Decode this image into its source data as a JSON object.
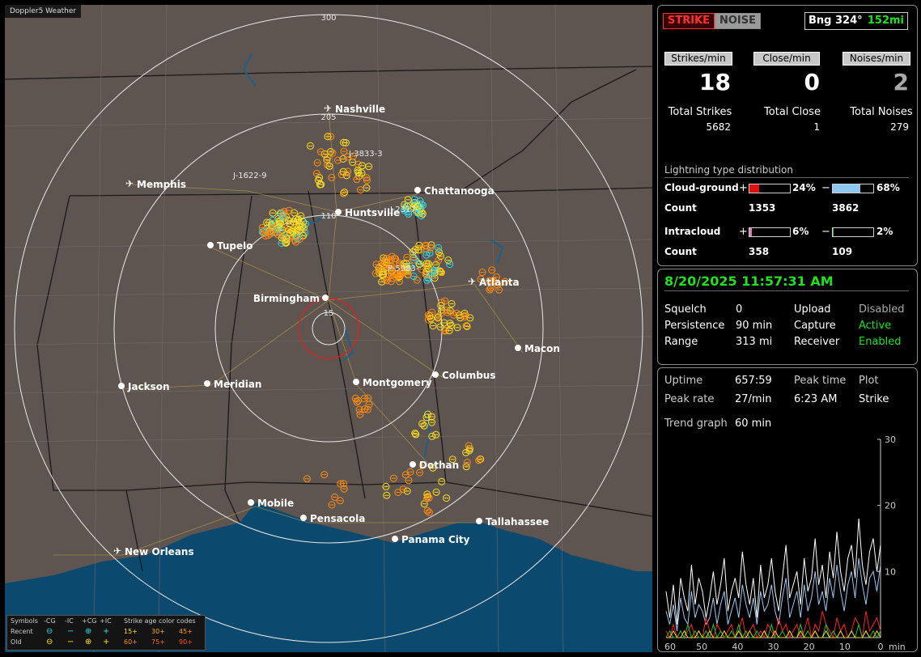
{
  "app": {
    "brand": "Doppler5 Weather"
  },
  "map": {
    "range_labels": [
      "300",
      "205",
      "110",
      "15"
    ],
    "cities": [
      {
        "name": "Nashville",
        "airport": true
      },
      {
        "name": "Memphis",
        "airport": true
      },
      {
        "name": "Chattanooga",
        "airport": false
      },
      {
        "name": "Huntsville",
        "airport": false
      },
      {
        "name": "Tupelo",
        "airport": false
      },
      {
        "name": "Birmingham",
        "airport": false
      },
      {
        "name": "Atlanta",
        "airport": true
      },
      {
        "name": "Macon",
        "airport": false
      },
      {
        "name": "Jackson",
        "airport": false
      },
      {
        "name": "Meridian",
        "airport": false
      },
      {
        "name": "Montgomery",
        "airport": false
      },
      {
        "name": "Columbus",
        "airport": false
      },
      {
        "name": "Dothan",
        "airport": false
      },
      {
        "name": "Mobile",
        "airport": false
      },
      {
        "name": "Pensacola",
        "airport": false
      },
      {
        "name": "Tallahassee",
        "airport": false
      },
      {
        "name": "Panama City",
        "airport": false
      },
      {
        "name": "New Orleans",
        "airport": true
      }
    ],
    "cell_tags": [
      "J-1622-9",
      "J-3833-3",
      "J-2317-",
      "P-5983-"
    ],
    "legend": {
      "symbols_label": "Symbols",
      "cols": [
        "-CG",
        "-IC",
        "+CG",
        "+IC"
      ],
      "age_title": "Strike age color codes",
      "recent_label": "Recent",
      "old_label": "Old",
      "recent_symbols": [
        "⊖",
        "−",
        "⊕",
        "+"
      ],
      "old_symbols": [
        "⊖",
        "−",
        "⊕",
        "+"
      ],
      "recent_ages": [
        "15+",
        "30+",
        "45+"
      ],
      "old_ages": [
        "60+",
        "75+",
        "90+"
      ]
    }
  },
  "top": {
    "strike_button": "STRIKE",
    "noise_button": "NOISE",
    "bearing": "Bng 324°",
    "distance": "152mi"
  },
  "rates": {
    "headers": [
      "Strikes/min",
      "Close/min",
      "Noises/min"
    ],
    "values": [
      "18",
      "0",
      "2"
    ],
    "total_labels": [
      "Total Strikes",
      "Total Close",
      "Total Noises"
    ],
    "totals": [
      "5682",
      "1",
      "279"
    ]
  },
  "distribution": {
    "title": "Lightning type distribution",
    "cg_label": "Cloud-ground",
    "ic_label": "Intracloud",
    "count_label": "Count",
    "plus": "+",
    "minus": "−",
    "cg_pos_pct": "24%",
    "cg_neg_pct": "68%",
    "ic_pos_pct": "6%",
    "ic_neg_pct": "2%",
    "cg_pos_count": "1353",
    "cg_neg_count": "3862",
    "ic_pos_count": "358",
    "ic_neg_count": "109",
    "fractions": {
      "cg_pos": 0.24,
      "cg_neg": 0.68,
      "ic_pos": 0.06,
      "ic_neg": 0.02
    },
    "colors": {
      "cg_pos": "#e01010",
      "cg_neg": "#8ec8f0",
      "ic_pos": "#e080b0",
      "ic_neg": "#30c060"
    }
  },
  "status": {
    "datetime": "8/20/2025 11:57:31 AM",
    "rows": [
      {
        "label": "Squelch",
        "value": "0",
        "label2": "Upload",
        "value2": "Disabled"
      },
      {
        "label": "Persistence",
        "value": "90 min",
        "label2": "Capture",
        "value2": "Active"
      },
      {
        "label": "Range",
        "value": "313 mi",
        "label2": "Receiver",
        "value2": "Enabled"
      }
    ]
  },
  "stats": {
    "uptime_label": "Uptime",
    "uptime": "657:59",
    "peak_time_label": "Peak time",
    "peak_time": "6:23 AM",
    "plot_label": "Plot",
    "plot_value": "Strike",
    "peak_rate_label": "Peak rate",
    "peak_rate": "27/min",
    "trend_label": "Trend graph",
    "trend_value": "60 min"
  },
  "chart_data": {
    "type": "line",
    "xlabel": "min",
    "x_ticks": [
      "60",
      "50",
      "40",
      "30",
      "20",
      "10",
      "0"
    ],
    "y_ticks": [
      "30",
      "20",
      "10"
    ],
    "ylim": [
      0,
      30
    ],
    "xlim": [
      60,
      0
    ],
    "series": [
      {
        "color": "#ffffff",
        "values": [
          7,
          3,
          8,
          2,
          9,
          6,
          4,
          11,
          5,
          9,
          7,
          3,
          6,
          10,
          5,
          8,
          12,
          4,
          7,
          9,
          6,
          13,
          8,
          5,
          9,
          3,
          11,
          6,
          8,
          12,
          7,
          4,
          9,
          14,
          6,
          8,
          10,
          5,
          12,
          7,
          9,
          15,
          8,
          11,
          6,
          13,
          9,
          16,
          10,
          7,
          12,
          14,
          9,
          18,
          11,
          8,
          13,
          15,
          10,
          14
        ]
      },
      {
        "color": "#9ec8f0",
        "values": [
          4,
          2,
          5,
          1,
          6,
          3,
          2,
          7,
          3,
          5,
          4,
          2,
          3,
          6,
          2,
          5,
          7,
          2,
          4,
          6,
          3,
          8,
          5,
          3,
          6,
          2,
          7,
          4,
          5,
          8,
          4,
          2,
          6,
          9,
          3,
          5,
          7,
          3,
          8,
          4,
          6,
          10,
          5,
          7,
          4,
          9,
          6,
          11,
          7,
          4,
          8,
          10,
          6,
          12,
          8,
          5,
          9,
          10,
          7,
          11
        ]
      },
      {
        "color": "#ff2020",
        "values": [
          1,
          0,
          2,
          0,
          1,
          0,
          1,
          2,
          0,
          1,
          0,
          3,
          1,
          0,
          2,
          1,
          0,
          1,
          2,
          0,
          1,
          3,
          0,
          1,
          2,
          0,
          1,
          0,
          2,
          1,
          0,
          3,
          1,
          2,
          0,
          1,
          2,
          0,
          1,
          3,
          0,
          2,
          1,
          4,
          2,
          1,
          0,
          3,
          1,
          2,
          0,
          1,
          3,
          2,
          0,
          4,
          1,
          2,
          3,
          1
        ]
      },
      {
        "color": "#20c040",
        "values": [
          0,
          1,
          0,
          0,
          1,
          0,
          2,
          0,
          1,
          0,
          0,
          1,
          0,
          2,
          0,
          1,
          0,
          0,
          1,
          0,
          2,
          0,
          1,
          0,
          0,
          1,
          0,
          1,
          0,
          2,
          0,
          0,
          1,
          0,
          1,
          0,
          0,
          2,
          0,
          1,
          0,
          1,
          0,
          0,
          2,
          0,
          1,
          0,
          1,
          0,
          0,
          1,
          0,
          2,
          0,
          1,
          0,
          1,
          0,
          1
        ]
      },
      {
        "color": "#ffd020",
        "values": [
          0,
          0,
          1,
          0,
          0,
          1,
          0,
          0,
          0,
          1,
          0,
          0,
          1,
          0,
          0,
          0,
          1,
          0,
          0,
          0,
          1,
          0,
          0,
          1,
          0,
          0,
          0,
          1,
          0,
          0,
          1,
          0,
          0,
          0,
          1,
          0,
          0,
          1,
          0,
          0,
          0,
          1,
          0,
          0,
          1,
          0,
          0,
          0,
          1,
          0,
          0,
          1,
          0,
          0,
          0,
          1,
          0,
          0,
          1,
          0
        ]
      }
    ]
  },
  "colors": {
    "map_land": "#5f5550",
    "water": "#0b4a6e",
    "ring": "#e8e8e8",
    "inner_ring": "#e02020",
    "status_green": "#20e020",
    "strike_red": "#ff3030",
    "strike_yellow": "#ffe020",
    "strike_orange": "#ff8c10",
    "strike_cyan": "#30d8e8"
  }
}
